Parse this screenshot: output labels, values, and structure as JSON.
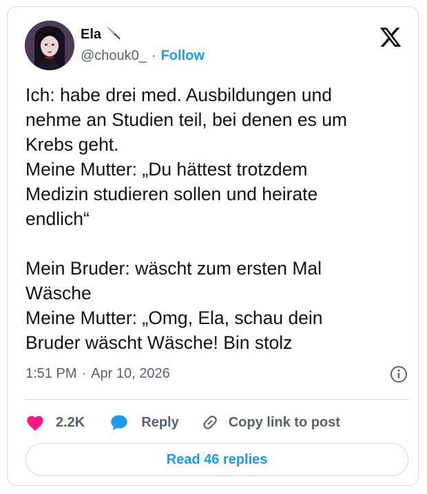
{
  "author": {
    "display_name": "Ela",
    "name_emoji": "knife-emoji",
    "handle": "@chouk0_",
    "separator": "·",
    "follow_label": "Follow"
  },
  "brand": {
    "logo": "x-logo-icon"
  },
  "tweet": {
    "text": "Ich: habe drei med. Ausbildungen und\nnehme an Studien teil, bei denen es um\nKrebs geht.\nMeine Mutter: „Du hättest trotzdem\nMedizin studieren sollen und heirate\nendlich“\n\nMein Bruder: wäscht zum ersten Mal\nWäsche\nMeine Mutter: „Omg, Ela, schau dein\nBruder wäscht Wäsche! Bin stolz"
  },
  "meta": {
    "time": "1:51 PM",
    "separator": "·",
    "date": "Apr 10, 2026",
    "info_icon": "info-icon"
  },
  "actions": {
    "like_count": "2.2K",
    "reply_label": "Reply",
    "copy_label": "Copy link to post"
  },
  "footer": {
    "read_replies_label": "Read 46 replies"
  },
  "colors": {
    "accent": "#1d9bf0",
    "like": "#f91880",
    "text": "#0f1419",
    "secondary": "#536471",
    "border": "#d6d9db"
  }
}
